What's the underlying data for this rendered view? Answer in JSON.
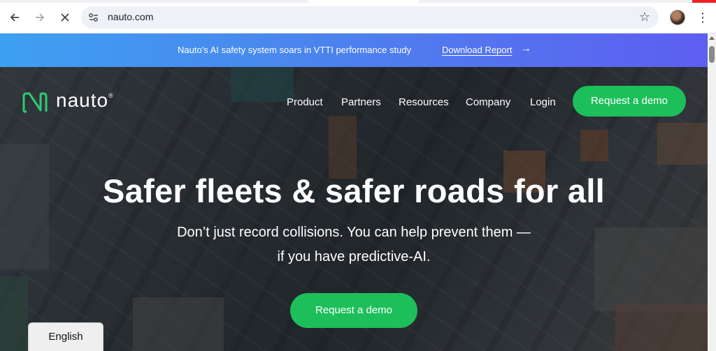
{
  "browser": {
    "url": "nauto.com",
    "back_icon": "arrow-left-icon",
    "forward_icon": "arrow-right-icon",
    "stop_icon": "close-icon",
    "site_info_icon": "tune-icon",
    "bookmark_icon": "star-icon",
    "menu_icon": "kebab-icon"
  },
  "banner": {
    "message": "Nauto's AI safety system soars in VTTI performance study",
    "link_label": "Download Report",
    "arrow": "→"
  },
  "header": {
    "brand": "nauto",
    "brand_mark": "®",
    "nav": [
      {
        "label": "Product"
      },
      {
        "label": "Partners"
      },
      {
        "label": "Resources"
      },
      {
        "label": "Company"
      },
      {
        "label": "Login"
      }
    ],
    "cta_label": "Request a demo"
  },
  "hero": {
    "headline": "Safer fleets & safer roads for all",
    "subline_1": "Don’t just record collisions. You can help prevent them —",
    "subline_2": "if you have predictive-AI.",
    "cta_label": "Request a demo"
  },
  "language": {
    "label": "English"
  },
  "colors": {
    "accent_green": "#1dbf5a",
    "banner_start": "#3ea0f0",
    "banner_end": "#5e5ef0",
    "logo_green": "#2ecc71"
  }
}
